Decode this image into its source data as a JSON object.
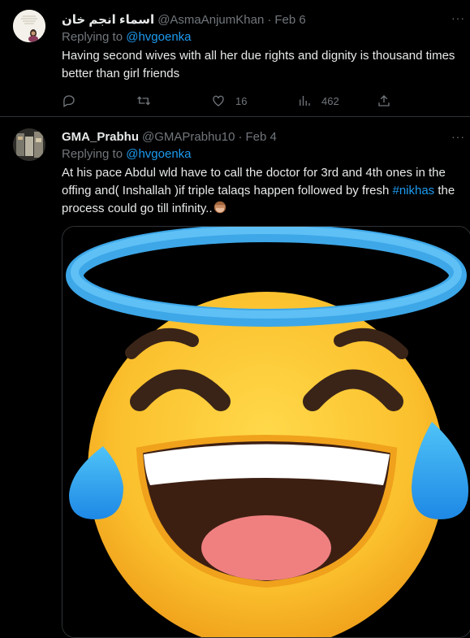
{
  "tweets": [
    {
      "display_name": "اسماء انجم خان",
      "handle": "@AsmaAnjumKhan",
      "date": "Feb 6",
      "replying_label": "Replying to",
      "replying_to": "@hvgoenka",
      "text": "Having second wives with all her due rights and dignity is thousand times better than girl friends",
      "likes": "16",
      "views": "462"
    },
    {
      "display_name": "GMA_Prabhu",
      "handle": "@GMAPrabhu10",
      "date": "Feb 4",
      "replying_label": "Replying to",
      "replying_to": "@hvgoenka",
      "text_part1": "At his pace Abdul wld have to call the doctor for 3rd and 4th ones in the offing and( Inshallah )if triple talaqs happen followed by fresh ",
      "hashtag": "#nikhas",
      "text_part2": " the process could go till infinity..",
      "media_icon": "smiling-face-with-halo-and-tears-of-joy-emoji"
    }
  ],
  "dot_separator": "·",
  "more_glyph": "···",
  "icons": {
    "reply": "reply-icon",
    "retweet": "retweet-icon",
    "like": "heart-icon",
    "views": "views-icon",
    "share": "share-icon"
  },
  "colors": {
    "background": "#000000",
    "text": "#e7e9ea",
    "secondary": "#71767b",
    "link": "#1d9bf0",
    "divider": "#2f3336"
  }
}
